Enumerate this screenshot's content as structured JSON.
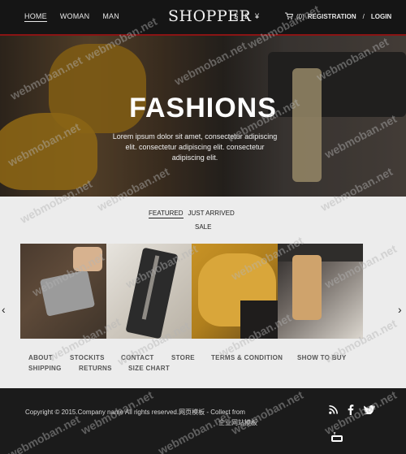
{
  "nav": {
    "items": [
      {
        "label": "HOME",
        "active": true
      },
      {
        "label": "WOMAN",
        "active": false
      },
      {
        "label": "MAN",
        "active": false
      }
    ],
    "logo": "SHOPPER",
    "currencies": [
      "$",
      "£",
      "¥"
    ],
    "cart_count": "(0)",
    "registration": "REGISTRATION",
    "separator": "/",
    "login": "LOGIN"
  },
  "hero": {
    "title": "FASHIONS",
    "text": "Lorem ipsum dolor sit amet, consectetur adipiscing elit. consectetur adipiscing elit. consectetur adipiscing elit."
  },
  "tabs": {
    "featured": "FEATURED",
    "just_arrived": "JUST ARRIVED",
    "sale": "SALE"
  },
  "carousel": {
    "prev": "‹",
    "next": "›"
  },
  "footer_links": {
    "row1": [
      "ABOUT",
      "STOCKITS",
      "CONTACT",
      "STORE",
      "TERMS & CONDITION",
      "SHOW TO BUY"
    ],
    "row2": [
      "SHIPPING",
      "RETURNS",
      "SIZE CHART"
    ]
  },
  "footer": {
    "copyright_line1": "Copyright © 2015.Company name All rights reserved.网页模板 - Collect from",
    "copyright_line2": "企业网站模板"
  },
  "watermark": "webmoban.net",
  "colors": {
    "topbar_bg": "#151515",
    "accent_line": "#8a1414",
    "page_bg": "#ececec",
    "footer_bg": "#1b1b1b"
  }
}
